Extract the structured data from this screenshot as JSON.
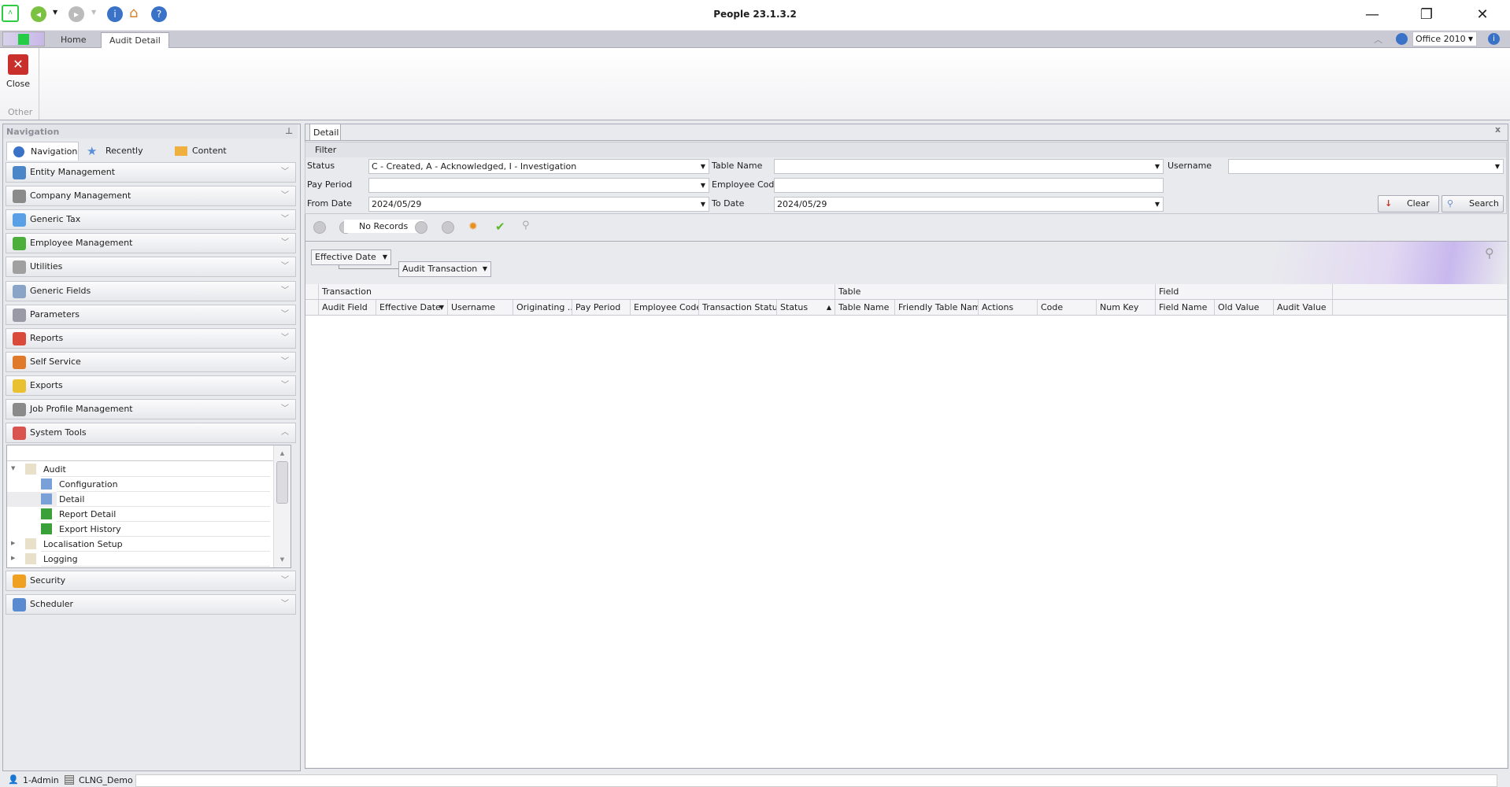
{
  "app": {
    "title": "People 23.1.3.2"
  },
  "quick_access": {
    "icons": [
      "app-logo-icon",
      "back-icon",
      "dropdown-icon",
      "forward-icon",
      "info-icon",
      "home-icon",
      "help-icon"
    ]
  },
  "ribbon": {
    "tabs": [
      "Home",
      "Audit Detail"
    ],
    "active_tab": "Audit Detail",
    "close_label": "Close",
    "group_label": "Other",
    "theme": "Office 2010"
  },
  "navigation": {
    "title": "Navigation",
    "tabs": [
      "Navigation",
      "Recently Used",
      "Content"
    ],
    "groups": [
      {
        "label": "Entity Management",
        "color": "#4a86c8"
      },
      {
        "label": "Company Management",
        "color": "#8a8a8a"
      },
      {
        "label": "Generic Tax",
        "color": "#5aa0e6"
      },
      {
        "label": "Employee Management",
        "color": "#4caf3c"
      },
      {
        "label": "Utilities",
        "color": "#a0a0a0"
      },
      {
        "label": "Generic Fields",
        "color": "#8aa4c8"
      },
      {
        "label": "Parameters",
        "color": "#9a9aa6"
      },
      {
        "label": "Reports",
        "color": "#d94a3a"
      },
      {
        "label": "Self Service",
        "color": "#e07a2a"
      },
      {
        "label": "Exports",
        "color": "#e8c030"
      },
      {
        "label": "Job Profile Management",
        "color": "#8a8a8a"
      },
      {
        "label": "System Tools",
        "color": "#d9534f"
      }
    ],
    "tree": [
      {
        "label": "Audit",
        "level": 0,
        "expanded": true
      },
      {
        "label": "Configuration",
        "level": 1
      },
      {
        "label": "Detail",
        "level": 1,
        "selected": true
      },
      {
        "label": "Report Detail",
        "level": 1
      },
      {
        "label": "Export History",
        "level": 1
      },
      {
        "label": "Localisation Setup",
        "level": 0
      },
      {
        "label": "Logging",
        "level": 0
      }
    ],
    "bottom_groups": [
      {
        "label": "Security",
        "color": "#f0a020"
      },
      {
        "label": "Scheduler",
        "color": "#5a8ad0"
      }
    ]
  },
  "detail": {
    "tab": "Detail",
    "filter": {
      "title": "Filter",
      "status_label": "Status",
      "status_value": "C - Created, A - Acknowledged, I - Investigation",
      "table_name_label": "Table Name",
      "table_name_value": "",
      "username_label": "Username",
      "username_value": "",
      "pay_period_label": "Pay Period",
      "pay_period_value": "",
      "employee_code_label": "Employee Code",
      "employee_code_value": "",
      "from_date_label": "From Date",
      "from_date_value": "2024/05/29",
      "to_date_label": "To Date",
      "to_date_value": "2024/05/29",
      "clear_label": "Clear",
      "search_label": "Search"
    },
    "navigator": {
      "records_text": "No Records"
    },
    "group_by": [
      "Effective Date",
      "Audit Transaction"
    ],
    "bands": [
      "Transaction",
      "Table",
      "Field"
    ],
    "columns": [
      "Audit Field",
      "Effective Date",
      "Username",
      "Originating ...",
      "Pay Period",
      "Employee Code",
      "Transaction Status",
      "Status",
      "Table Name",
      "Friendly Table Name",
      "Actions",
      "Code",
      "Num Key",
      "Field Name",
      "Old Value",
      "Audit Value"
    ],
    "rows": []
  },
  "statusbar": {
    "user": "1-Admin",
    "database": "CLNG_Demo"
  }
}
